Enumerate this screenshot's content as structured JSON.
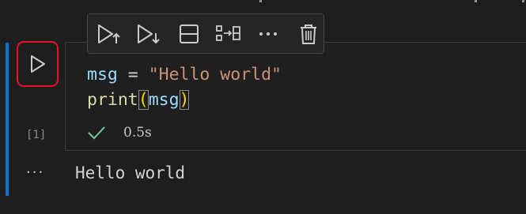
{
  "toolbar": {
    "buttons": [
      {
        "icon": "execute-above-icon",
        "label": "Execute Above Cells"
      },
      {
        "icon": "execute-below-icon",
        "label": "Execute Cell and Below"
      },
      {
        "icon": "split-cell-icon",
        "label": "Split Cell"
      },
      {
        "icon": "join-cells-icon",
        "label": "Join With Next Cell"
      },
      {
        "icon": "more-actions-icon",
        "label": "More Actions"
      },
      {
        "icon": "delete-icon",
        "label": "Delete Cell"
      }
    ]
  },
  "cell": {
    "run_icon": "play-icon",
    "execution_count": "[1]",
    "code": {
      "line1": {
        "var": "msg",
        "op": " = ",
        "str": "\"Hello world\""
      },
      "line2": {
        "fn": "print",
        "open_paren": "(",
        "arg": "msg",
        "close_paren": ")"
      }
    },
    "status": {
      "icon": "check-icon",
      "duration": "0.5s"
    }
  },
  "output": {
    "menu_label": "···",
    "text": "Hello world"
  },
  "colors": {
    "background": "#1e1e1e",
    "focus_bar": "#0078d4",
    "run_highlight": "#e81123",
    "success": "#73c991",
    "string": "#ce9178",
    "function": "#dcdcaa",
    "variable": "#9cdcfe",
    "bracket": "#ffd700"
  }
}
